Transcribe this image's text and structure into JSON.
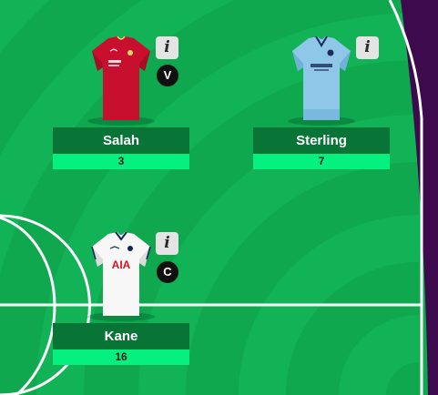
{
  "info_icon_glyph": "i",
  "colors": {
    "pitch": "#0fa84f",
    "name_box": "#087436",
    "points_box": "#05f07e"
  },
  "players": [
    {
      "name": "Salah",
      "points": "3",
      "badge": "V",
      "shirt": "liverpool-shirt-icon"
    },
    {
      "name": "Sterling",
      "points": "7",
      "badge": "",
      "shirt": "man-city-shirt-icon"
    },
    {
      "name": "Kane",
      "points": "16",
      "badge": "C",
      "shirt": "tottenham-shirt-icon"
    }
  ]
}
